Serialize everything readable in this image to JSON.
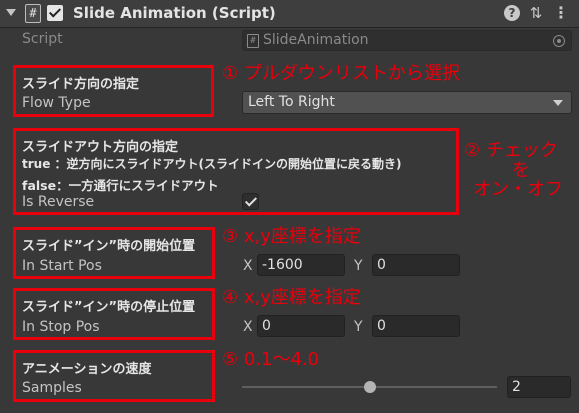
{
  "component": {
    "title": "Slide Animation (Script)",
    "icon": "script-hash-icon",
    "enabled": true
  },
  "script": {
    "label": "Script",
    "value": "SlideAnimation"
  },
  "flow_type": {
    "heading": "スライド方向の指定",
    "label": "Flow Type",
    "value": "Left To Right",
    "annotation": "① プルダウンリストから選択"
  },
  "reverse": {
    "heading": "スライドアウト方向の指定",
    "desc_true": "true ：逆方向にスライドアウト(スライドインの開始位置に戻る動き)",
    "desc_false": "false：一方通行にスライドアウト",
    "label": "Is Reverse",
    "checked": true,
    "annotation_line1": "② チェック",
    "annotation_line2": "を",
    "annotation_line3": "オン・オフ"
  },
  "start_pos": {
    "heading": "スライド”イン”時の開始位置",
    "label": "In Start Pos",
    "x_label": "X",
    "x": "-1600",
    "y_label": "Y",
    "y": "0",
    "annotation": "③ x,y座標を指定"
  },
  "stop_pos": {
    "heading": "スライド”イン”時の停止位置",
    "label": "In Stop Pos",
    "x_label": "X",
    "x": "0",
    "y_label": "Y",
    "y": "0",
    "annotation": "④ x,y座標を指定"
  },
  "samples": {
    "heading": "アニメーションの速度",
    "label": "Samples",
    "value": "2",
    "slider_fraction": 0.5,
    "annotation": "⑤ 0.1～4.0"
  },
  "colors": {
    "annotation_red": "#e8000c",
    "panel_bg": "#383838"
  }
}
